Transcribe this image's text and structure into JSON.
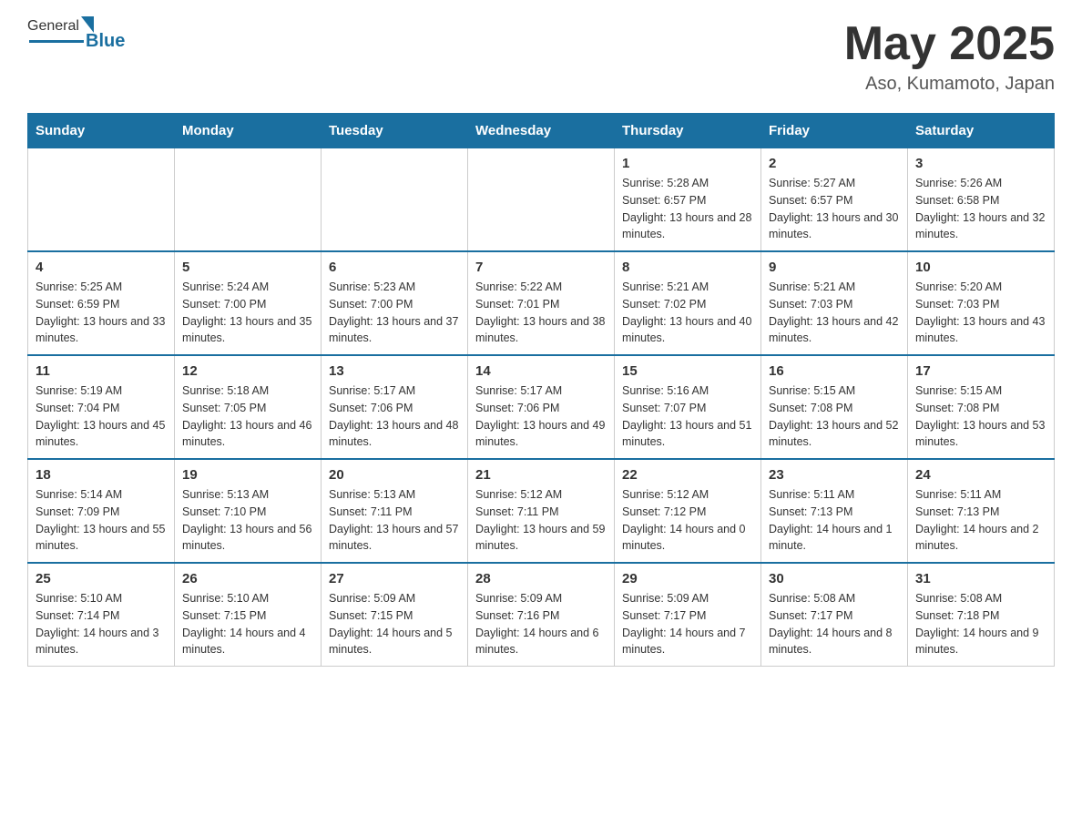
{
  "header": {
    "logo_general": "General",
    "logo_blue": "Blue",
    "month_title": "May 2025",
    "location": "Aso, Kumamoto, Japan"
  },
  "weekdays": [
    "Sunday",
    "Monday",
    "Tuesday",
    "Wednesday",
    "Thursday",
    "Friday",
    "Saturday"
  ],
  "weeks": [
    [
      {
        "day": "",
        "info": ""
      },
      {
        "day": "",
        "info": ""
      },
      {
        "day": "",
        "info": ""
      },
      {
        "day": "",
        "info": ""
      },
      {
        "day": "1",
        "info": "Sunrise: 5:28 AM\nSunset: 6:57 PM\nDaylight: 13 hours and 28 minutes."
      },
      {
        "day": "2",
        "info": "Sunrise: 5:27 AM\nSunset: 6:57 PM\nDaylight: 13 hours and 30 minutes."
      },
      {
        "day": "3",
        "info": "Sunrise: 5:26 AM\nSunset: 6:58 PM\nDaylight: 13 hours and 32 minutes."
      }
    ],
    [
      {
        "day": "4",
        "info": "Sunrise: 5:25 AM\nSunset: 6:59 PM\nDaylight: 13 hours and 33 minutes."
      },
      {
        "day": "5",
        "info": "Sunrise: 5:24 AM\nSunset: 7:00 PM\nDaylight: 13 hours and 35 minutes."
      },
      {
        "day": "6",
        "info": "Sunrise: 5:23 AM\nSunset: 7:00 PM\nDaylight: 13 hours and 37 minutes."
      },
      {
        "day": "7",
        "info": "Sunrise: 5:22 AM\nSunset: 7:01 PM\nDaylight: 13 hours and 38 minutes."
      },
      {
        "day": "8",
        "info": "Sunrise: 5:21 AM\nSunset: 7:02 PM\nDaylight: 13 hours and 40 minutes."
      },
      {
        "day": "9",
        "info": "Sunrise: 5:21 AM\nSunset: 7:03 PM\nDaylight: 13 hours and 42 minutes."
      },
      {
        "day": "10",
        "info": "Sunrise: 5:20 AM\nSunset: 7:03 PM\nDaylight: 13 hours and 43 minutes."
      }
    ],
    [
      {
        "day": "11",
        "info": "Sunrise: 5:19 AM\nSunset: 7:04 PM\nDaylight: 13 hours and 45 minutes."
      },
      {
        "day": "12",
        "info": "Sunrise: 5:18 AM\nSunset: 7:05 PM\nDaylight: 13 hours and 46 minutes."
      },
      {
        "day": "13",
        "info": "Sunrise: 5:17 AM\nSunset: 7:06 PM\nDaylight: 13 hours and 48 minutes."
      },
      {
        "day": "14",
        "info": "Sunrise: 5:17 AM\nSunset: 7:06 PM\nDaylight: 13 hours and 49 minutes."
      },
      {
        "day": "15",
        "info": "Sunrise: 5:16 AM\nSunset: 7:07 PM\nDaylight: 13 hours and 51 minutes."
      },
      {
        "day": "16",
        "info": "Sunrise: 5:15 AM\nSunset: 7:08 PM\nDaylight: 13 hours and 52 minutes."
      },
      {
        "day": "17",
        "info": "Sunrise: 5:15 AM\nSunset: 7:08 PM\nDaylight: 13 hours and 53 minutes."
      }
    ],
    [
      {
        "day": "18",
        "info": "Sunrise: 5:14 AM\nSunset: 7:09 PM\nDaylight: 13 hours and 55 minutes."
      },
      {
        "day": "19",
        "info": "Sunrise: 5:13 AM\nSunset: 7:10 PM\nDaylight: 13 hours and 56 minutes."
      },
      {
        "day": "20",
        "info": "Sunrise: 5:13 AM\nSunset: 7:11 PM\nDaylight: 13 hours and 57 minutes."
      },
      {
        "day": "21",
        "info": "Sunrise: 5:12 AM\nSunset: 7:11 PM\nDaylight: 13 hours and 59 minutes."
      },
      {
        "day": "22",
        "info": "Sunrise: 5:12 AM\nSunset: 7:12 PM\nDaylight: 14 hours and 0 minutes."
      },
      {
        "day": "23",
        "info": "Sunrise: 5:11 AM\nSunset: 7:13 PM\nDaylight: 14 hours and 1 minute."
      },
      {
        "day": "24",
        "info": "Sunrise: 5:11 AM\nSunset: 7:13 PM\nDaylight: 14 hours and 2 minutes."
      }
    ],
    [
      {
        "day": "25",
        "info": "Sunrise: 5:10 AM\nSunset: 7:14 PM\nDaylight: 14 hours and 3 minutes."
      },
      {
        "day": "26",
        "info": "Sunrise: 5:10 AM\nSunset: 7:15 PM\nDaylight: 14 hours and 4 minutes."
      },
      {
        "day": "27",
        "info": "Sunrise: 5:09 AM\nSunset: 7:15 PM\nDaylight: 14 hours and 5 minutes."
      },
      {
        "day": "28",
        "info": "Sunrise: 5:09 AM\nSunset: 7:16 PM\nDaylight: 14 hours and 6 minutes."
      },
      {
        "day": "29",
        "info": "Sunrise: 5:09 AM\nSunset: 7:17 PM\nDaylight: 14 hours and 7 minutes."
      },
      {
        "day": "30",
        "info": "Sunrise: 5:08 AM\nSunset: 7:17 PM\nDaylight: 14 hours and 8 minutes."
      },
      {
        "day": "31",
        "info": "Sunrise: 5:08 AM\nSunset: 7:18 PM\nDaylight: 14 hours and 9 minutes."
      }
    ]
  ]
}
